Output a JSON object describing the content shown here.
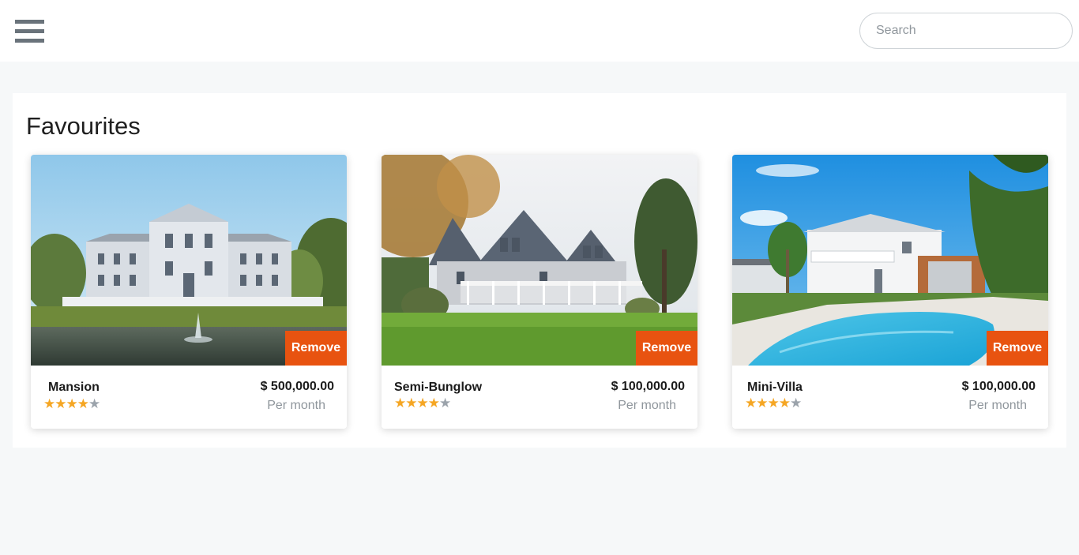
{
  "header": {
    "search_placeholder": "Search",
    "menu_icon": "hamburger-menu-icon"
  },
  "favourites": {
    "title": "Favourites",
    "remove_label": "Remove",
    "per_month_label": "Per month",
    "listings": [
      {
        "name": "Mansion",
        "price": "$ 500,000.00",
        "rating": 4,
        "max_rating": 5,
        "image": "mansion-with-pond-fountain"
      },
      {
        "name": "Semi-Bunglow",
        "price": "$ 100,000.00",
        "rating": 4,
        "max_rating": 5,
        "image": "grey-house-with-porch-and-lawn"
      },
      {
        "name": "Mini-Villa",
        "price": "$ 100,000.00",
        "rating": 4,
        "max_rating": 5,
        "image": "white-villa-with-swimming-pool"
      }
    ]
  },
  "colors": {
    "accent": "#e85310",
    "star": "#f5a623",
    "star_off": "#9ba3ab",
    "page_background": "#f6f8f9"
  }
}
